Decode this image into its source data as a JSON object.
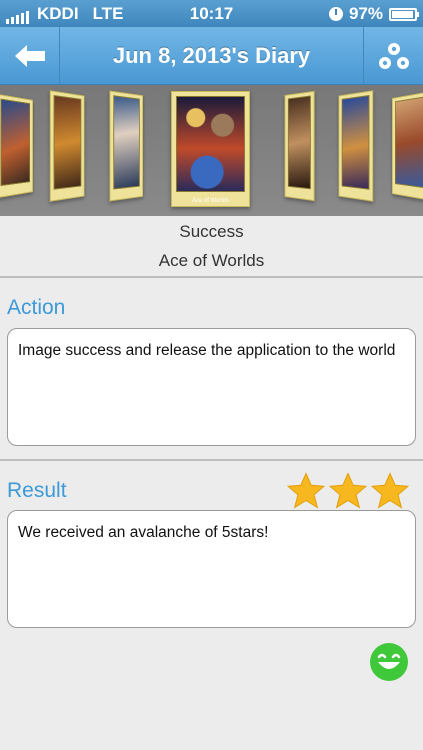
{
  "status_bar": {
    "carrier": "KDDI",
    "network": "LTE",
    "time": "10:17",
    "battery": "97%",
    "battery_level": 0.97
  },
  "nav": {
    "title": "Jun 8, 2013's Diary",
    "back_icon": "arrow-left-icon",
    "share_icon": "share-icon"
  },
  "carousel": {
    "center_card": "Ace of Worlds"
  },
  "card": {
    "name": "Success",
    "title": "Ace of Worlds"
  },
  "action": {
    "label": "Action",
    "text": "Image success and release the application to the world"
  },
  "result": {
    "label": "Result",
    "text": "We received an avalanche of 5stars!",
    "rating": 3,
    "rating_max": 3
  },
  "colors": {
    "accent": "#3c9ad8",
    "star": "#f6b81e",
    "smiley": "#3ec83a"
  }
}
